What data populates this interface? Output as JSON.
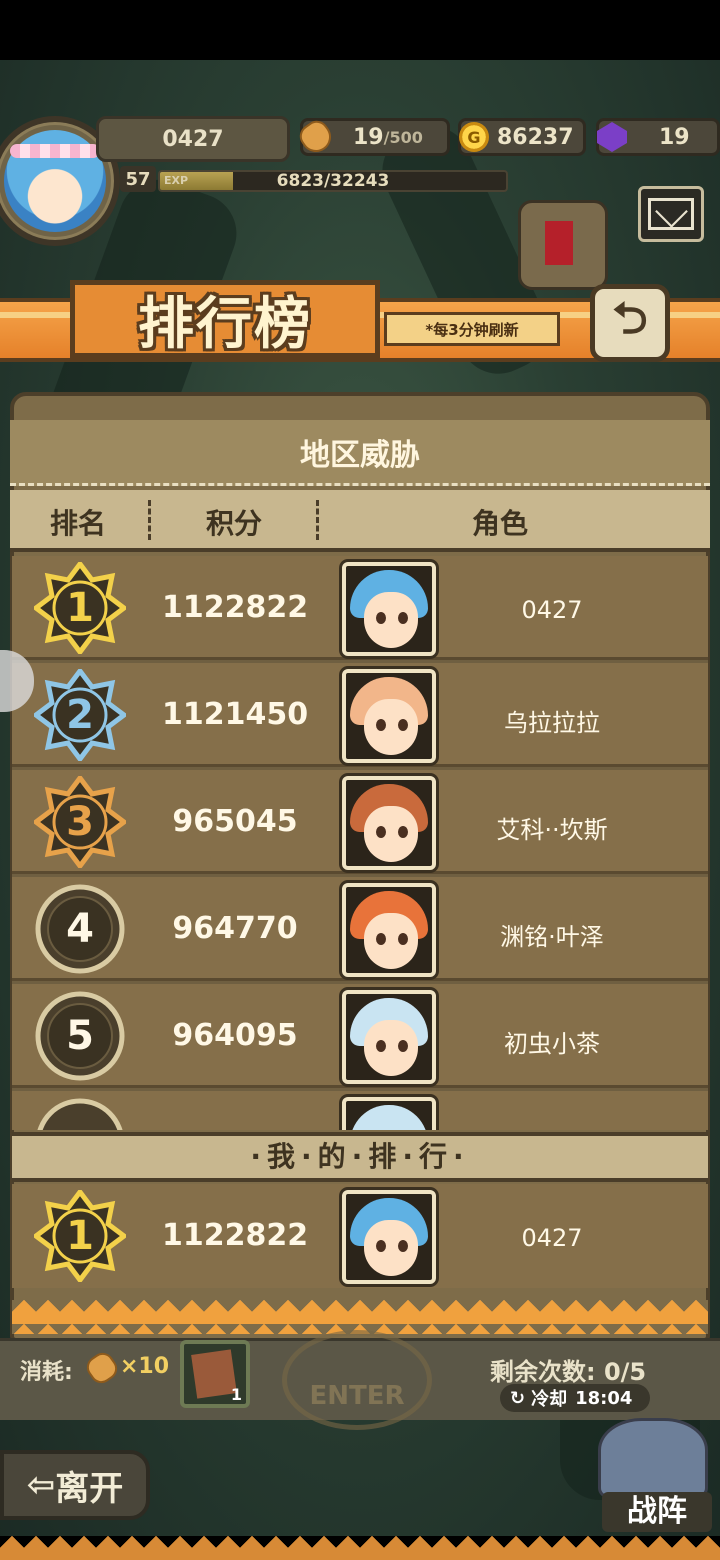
{
  "header": {
    "player_name": "0427",
    "level": "57",
    "exp_label": "EXP",
    "exp_value": "6823/32243",
    "exp_progress": 0.21,
    "bread": "19",
    "bread_max": "/500",
    "gold_icon": "G",
    "gold": "86237",
    "gems": "19"
  },
  "banner": {
    "title": "排行榜",
    "subtitle": "*每3分钟刷新",
    "back_icon": "⮌"
  },
  "panel": {
    "title": "地区威胁",
    "columns": {
      "rank": "排名",
      "score": "积分",
      "role": "角色"
    }
  },
  "rankings": [
    {
      "rank": "1",
      "score": "1122822",
      "name": "0427",
      "tier": "gold"
    },
    {
      "rank": "2",
      "score": "1121450",
      "name": "乌拉拉拉",
      "tier": "silver"
    },
    {
      "rank": "3",
      "score": "965045",
      "name": "艾科··坎斯",
      "tier": "bronze"
    },
    {
      "rank": "4",
      "score": "964770",
      "name": "渊铭·叶泽",
      "tier": "plain"
    },
    {
      "rank": "5",
      "score": "964095",
      "name": "初虫小茶",
      "tier": "plain"
    }
  ],
  "my_rank": {
    "label": "·我·的·排·行·",
    "rank": "1",
    "score": "1122822",
    "name": "0427"
  },
  "bottom": {
    "cost_label": "消耗:",
    "cost_multiplier": "×10",
    "ticket_count": "1",
    "enter_label": "ENTER",
    "remaining": "剩余次数: 0/5",
    "cooldown_label": "冷却",
    "cooldown_time": "18:04",
    "leave_label": "离开",
    "formation_label": "战阵"
  },
  "colors": {
    "gold": "#f3d14a",
    "silver": "#8fc6e6",
    "bronze": "#e7a24a",
    "plain": "#d9cba3",
    "banner": "#e68c34"
  }
}
